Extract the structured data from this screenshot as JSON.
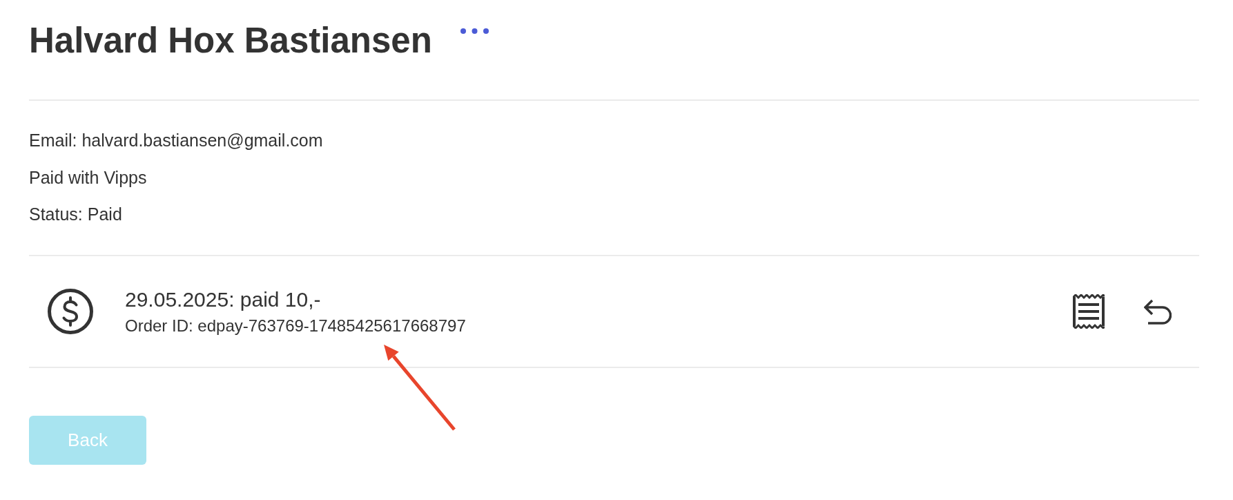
{
  "customer": {
    "name": "Halvard Hox Bastiansen"
  },
  "details": [
    "Email: halvard.bastiansen@gmail.com",
    "Paid with Vipps",
    "Status: Paid"
  ],
  "payments": [
    {
      "summary": "29.05.2025: paid 10,-",
      "order_id": "Order ID: edpay-763769-17485425617668797"
    }
  ],
  "back_button": {
    "label": "Back"
  }
}
